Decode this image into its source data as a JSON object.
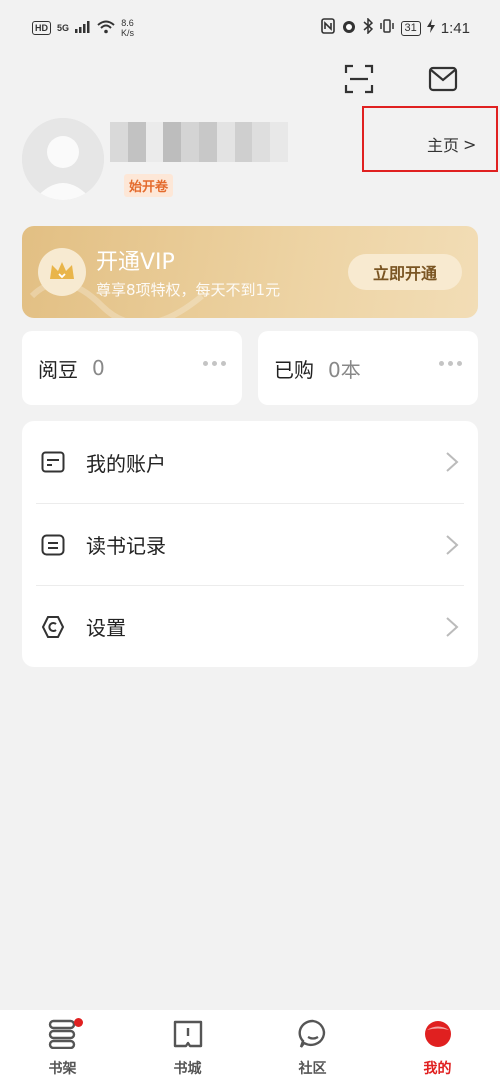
{
  "status_bar": {
    "hd": "HD",
    "signal": "5G",
    "speed_value": "8.6",
    "speed_unit": "K/s",
    "battery": "31",
    "time": "1:41"
  },
  "profile": {
    "tag": "始开卷",
    "homepage_label": "主页",
    "homepage_arrow": ">"
  },
  "vip": {
    "title": "开通VIP",
    "subtitle": "尊享8项特权，每天不到1元",
    "button": "立即开通"
  },
  "stats": [
    {
      "label": "阅豆",
      "value": "0"
    },
    {
      "label": "已购",
      "value": "0本"
    }
  ],
  "menu": [
    {
      "label": "我的账户",
      "icon": "wallet-icon"
    },
    {
      "label": "读书记录",
      "icon": "record-icon"
    },
    {
      "label": "设置",
      "icon": "settings-icon"
    }
  ],
  "bottom_nav": [
    {
      "label": "书架",
      "icon": "bookshelf-icon"
    },
    {
      "label": "书城",
      "icon": "bookstore-icon"
    },
    {
      "label": "社区",
      "icon": "community-icon"
    },
    {
      "label": "我的",
      "icon": "me-icon",
      "active": true
    }
  ],
  "colors": {
    "accent": "#e02020",
    "vip_gold": "#e2bf83",
    "background": "#f2f2f2"
  }
}
